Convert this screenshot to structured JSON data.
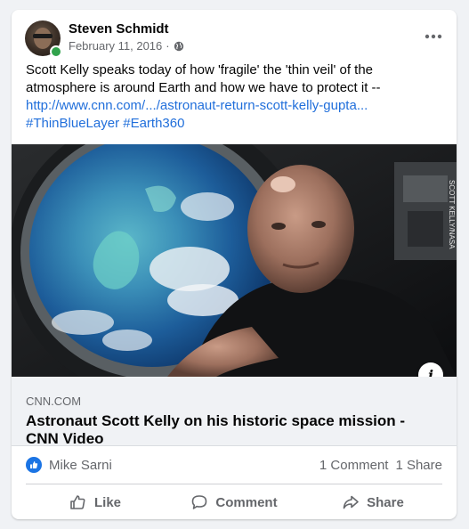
{
  "post": {
    "author": "Steven Schmidt",
    "date": "February 11, 2016",
    "separator": "·",
    "privacy_icon": "globe-icon",
    "more_icon": "more-options-icon",
    "text_line1": "Scott Kelly speaks today of how 'fragile' the 'thin veil' of the",
    "text_line2": "atmosphere is around Earth and how we have to protect it --",
    "link_text": "http://www.cnn.com/.../astronaut-return-scott-kelly-gupta...",
    "hashtags": "#ThinBlueLayer #Earth360"
  },
  "media": {
    "photo_credit": "SCOTT KELLY/NASA",
    "info_label": "i"
  },
  "link_preview": {
    "domain": "CNN.COM",
    "title": "Astronaut Scott Kelly on his historic space mission - CNN Video"
  },
  "reactions": {
    "reactor_name": "Mike Sarni",
    "comments_count": "1 Comment",
    "shares_count": "1 Share"
  },
  "actions": {
    "like_label": "Like",
    "comment_label": "Comment",
    "share_label": "Share"
  },
  "colors": {
    "link": "#216fdb",
    "like_blue": "#1b74e4",
    "online_green": "#31a24c",
    "secondary_text": "#65676b"
  }
}
